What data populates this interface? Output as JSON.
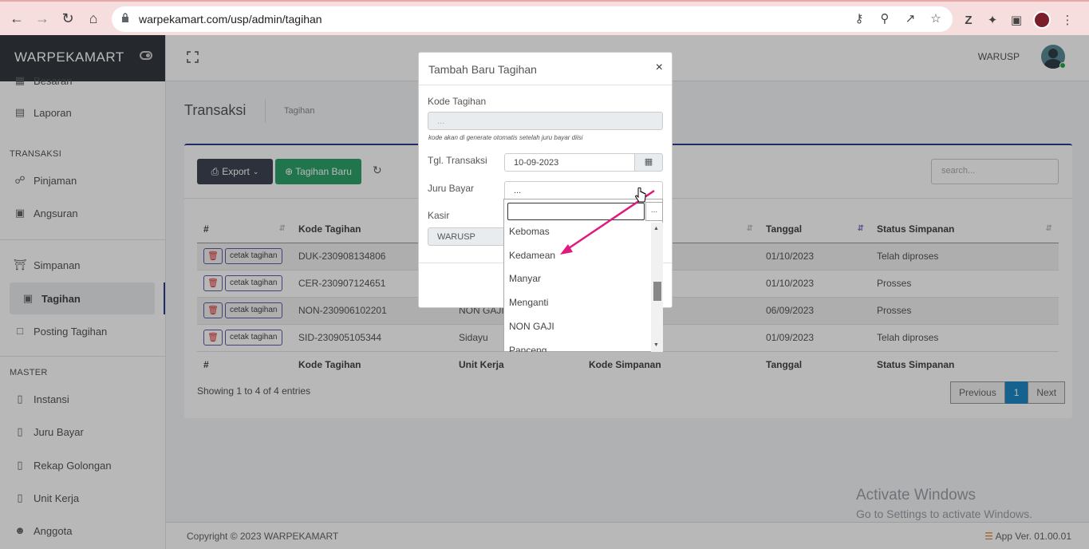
{
  "browser": {
    "url": "warpekamart.com/usp/admin/tagihan"
  },
  "sidebar": {
    "brand": "WARPEKAMART",
    "items_top": [
      {
        "label": "Besaran",
        "icon": "dollar-icon"
      },
      {
        "label": "Laporan",
        "icon": "clipboard-icon"
      }
    ],
    "section_transaksi": "TRANSAKSI",
    "items_transaksi": [
      {
        "label": "Pinjaman",
        "icon": "cart-icon"
      },
      {
        "label": "Angsuran",
        "icon": "money-icon"
      }
    ],
    "items_simpanan": [
      {
        "label": "Simpanan",
        "icon": "bank-icon"
      },
      {
        "label": "Tagihan",
        "icon": "money-icon"
      },
      {
        "label": "Posting Tagihan",
        "icon": "note-icon"
      }
    ],
    "section_master": "MASTER",
    "items_master": [
      {
        "label": "Instansi",
        "icon": "book-icon"
      },
      {
        "label": "Juru Bayar",
        "icon": "book-icon"
      },
      {
        "label": "Rekap Golongan",
        "icon": "book-icon"
      },
      {
        "label": "Unit Kerja",
        "icon": "book-icon"
      },
      {
        "label": "Anggota",
        "icon": "user-icon"
      }
    ]
  },
  "topbar": {
    "user": "WARUSP"
  },
  "page": {
    "title": "Transaksi",
    "breadcrumb": "Tagihan"
  },
  "toolbar": {
    "export": "Export",
    "new": "Tagihan Baru",
    "search_placeholder": "search..."
  },
  "table": {
    "columns": [
      "#",
      "Kode Tagihan",
      "Unit Kerja",
      "Kode Simpanan",
      "Tanggal",
      "Status Simpanan"
    ],
    "print_label": "cetak tagihan",
    "rows": [
      {
        "kode": "DUK-230908134806",
        "unit": "",
        "simpanan": "",
        "tanggal": "01/10/2023",
        "status": "Telah diproses"
      },
      {
        "kode": "CER-230907124651",
        "unit": "",
        "simpanan": "",
        "tanggal": "01/10/2023",
        "status": "Prosses"
      },
      {
        "kode": "NON-230906102201",
        "unit": "NON GAJI",
        "simpanan": "",
        "tanggal": "06/09/2023",
        "status": "Prosses"
      },
      {
        "kode": "SID-230905105344",
        "unit": "Sidayu",
        "simpanan": "",
        "tanggal": "01/09/2023",
        "status": "Telah diproses"
      }
    ],
    "showing": "Showing 1 to 4 of 4 entries",
    "pager": {
      "previous": "Previous",
      "page": "1",
      "next": "Next"
    }
  },
  "footer": {
    "copyright": "Copyright © 2023 WARPEKAMART",
    "version": "App Ver. 01.00.01"
  },
  "watermark": {
    "line1": "Activate Windows",
    "line2": "Go to Settings to activate Windows."
  },
  "modal": {
    "title": "Tambah Baru Tagihan",
    "close": "×",
    "kode_label": "Kode Tagihan",
    "kode_placeholder": "...",
    "kode_note": "kode akan di generate otomatis setelah juru bayar diisi",
    "tgl_label": "Tgl. Transaksi",
    "tgl_value": "10-09-2023",
    "juru_label": "Juru Bayar",
    "juru_value": "...",
    "kasir_label": "Kasir",
    "kasir_value": "WARUSP"
  },
  "dropdown": {
    "search_button": "...",
    "options": [
      "Kebomas",
      "Kedamean",
      "Manyar",
      "Menganti",
      "NON GAJI",
      "Panceng"
    ]
  },
  "colors": {
    "brand_dark": "#343a40",
    "primary": "#2c3e8f",
    "success": "#2ea36b",
    "annotation_arrow": "#e0197d"
  }
}
